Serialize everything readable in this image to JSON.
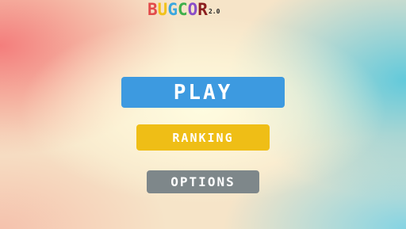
{
  "title": {
    "letters": [
      {
        "char": "B",
        "color": "#e24a4a"
      },
      {
        "char": "U",
        "color": "#f1c21b"
      },
      {
        "char": "G",
        "color": "#3aa7df"
      },
      {
        "char": "C",
        "color": "#3fb04a"
      },
      {
        "char": "O",
        "color": "#8a4fc8"
      },
      {
        "char": "R",
        "color": "#8b1e1e"
      }
    ],
    "version": "2.0"
  },
  "menu": {
    "play_label": "PLAY",
    "ranking_label": "RANKING",
    "options_label": "OPTIONS"
  },
  "colors": {
    "play": "#3d9ae0",
    "ranking": "#efbe16",
    "options": "#7e878a"
  }
}
